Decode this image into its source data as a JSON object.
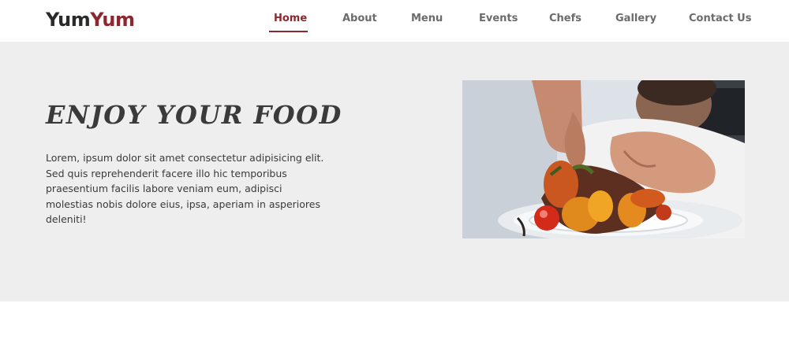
{
  "brand": {
    "part1": "Yum",
    "part2": "Yum"
  },
  "nav": {
    "items": [
      {
        "label": "Home",
        "active": true
      },
      {
        "label": "About"
      },
      {
        "label": "Menu"
      },
      {
        "label": "Events"
      },
      {
        "label": "Chefs"
      },
      {
        "label": "Gallery"
      },
      {
        "label": "Contact Us"
      }
    ]
  },
  "hero": {
    "title": "ENJOY YOUR FOOD",
    "text": "Lorem, ipsum dolor sit amet consectetur adipisicing elit. Sed quis reprehenderit facere illo hic temporibus praesentium facilis labore veniam eum, adipisci molestias nobis dolore eius, ipsa, aperiam in asperiores deleniti!",
    "image": "chef-plating-dish"
  },
  "colors": {
    "accent": "#8c2730",
    "nav_text": "#6b6b6b",
    "hero_bg": "#eeeeef"
  }
}
